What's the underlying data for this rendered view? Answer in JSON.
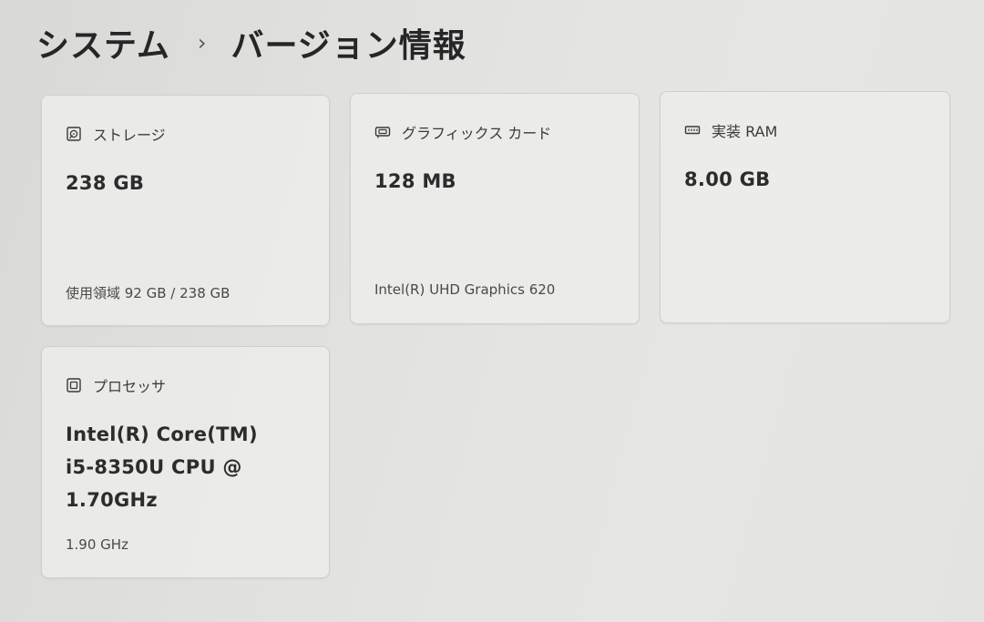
{
  "header": {
    "parent": "システム",
    "separator": "›",
    "title": "バージョン情報"
  },
  "cards": {
    "storage": {
      "icon": "storage-icon",
      "label": "ストレージ",
      "value": "238 GB",
      "detail": "使用領域 92 GB / 238 GB"
    },
    "graphics": {
      "icon": "graphics-card-icon",
      "label": "グラフィックス カード",
      "value": "128 MB",
      "detail": "Intel(R) UHD Graphics 620"
    },
    "ram": {
      "icon": "memory-icon",
      "label": "実装 RAM",
      "value": "8.00 GB"
    },
    "processor": {
      "icon": "processor-icon",
      "label": "プロセッサ",
      "value_lines": [
        "Intel(R) Core(TM)",
        "i5-8350U CPU @",
        "1.70GHz"
      ],
      "detail": "1.90 GHz"
    }
  }
}
